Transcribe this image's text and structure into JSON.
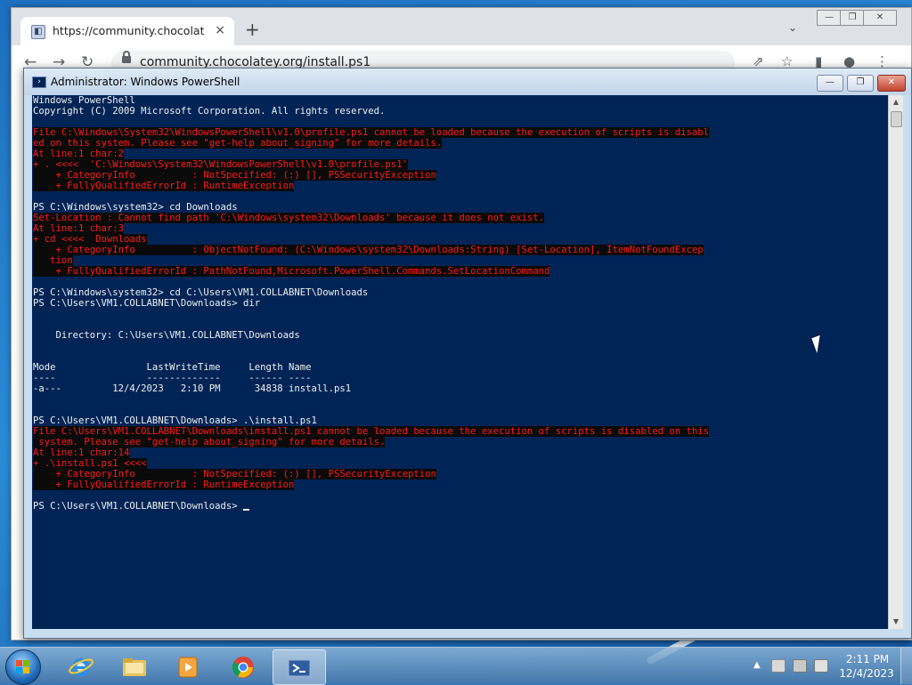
{
  "browser": {
    "tab_title": "https://community.chocolatey.or",
    "tab_close": "×",
    "new_tab": "+",
    "tab_search": "⌄",
    "address": "community.chocolatey.org/install.ps1",
    "window_controls": [
      "—",
      "❐",
      "✕"
    ]
  },
  "powershell": {
    "window_title": "Administrator: Windows PowerShell",
    "controls": [
      "—",
      "❐",
      "✕"
    ],
    "prompt_path": "PS C:\\Users\\VM1.COLLABNET\\Downloads> ",
    "lines": [
      {
        "text": "Windows PowerShell",
        "error": false
      },
      {
        "text": "Copyright (C) 2009 Microsoft Corporation. All rights reserved.",
        "error": false
      },
      {
        "text": "",
        "error": false
      },
      {
        "text": "File C:\\Windows\\System32\\WindowsPowerShell\\v1.0\\profile.ps1 cannot be loaded because the execution of scripts is disabl",
        "error": true
      },
      {
        "text": "ed on this system. Please see \"get-help about_signing\" for more details.",
        "error": true
      },
      {
        "text": "At line:1 char:2",
        "error": true
      },
      {
        "text": "+ . <<<<  'C:\\Windows\\System32\\WindowsPowerShell\\v1.0\\profile.ps1'",
        "error": true
      },
      {
        "text": "    + CategoryInfo          : NotSpecified: (:) [], PSSecurityException",
        "error": true
      },
      {
        "text": "    + FullyQualifiedErrorId : RuntimeException",
        "error": true
      },
      {
        "text": "",
        "error": false
      },
      {
        "text": "PS C:\\Windows\\system32> cd Downloads",
        "error": false
      },
      {
        "text": "Set-Location : Cannot find path 'C:\\Windows\\system32\\Downloads' because it does not exist.",
        "error": true
      },
      {
        "text": "At line:1 char:3",
        "error": true
      },
      {
        "text": "+ cd <<<<  Downloads",
        "error": true
      },
      {
        "text": "    + CategoryInfo          : ObjectNotFound: (C:\\Windows\\system32\\Downloads:String) [Set-Location], ItemNotFoundExcep",
        "error": true
      },
      {
        "text": "   tion",
        "error": true
      },
      {
        "text": "    + FullyQualifiedErrorId : PathNotFound,Microsoft.PowerShell.Commands.SetLocationCommand",
        "error": true
      },
      {
        "text": "",
        "error": false
      },
      {
        "text": "PS C:\\Windows\\system32> cd C:\\Users\\VM1.COLLABNET\\Downloads",
        "error": false
      },
      {
        "text": "PS C:\\Users\\VM1.COLLABNET\\Downloads> dir",
        "error": false
      },
      {
        "text": "",
        "error": false
      },
      {
        "text": "",
        "error": false
      },
      {
        "text": "    Directory: C:\\Users\\VM1.COLLABNET\\Downloads",
        "error": false
      },
      {
        "text": "",
        "error": false
      },
      {
        "text": "",
        "error": false
      },
      {
        "text": "Mode                LastWriteTime     Length Name",
        "error": false
      },
      {
        "text": "----                -------------     ------ ----",
        "error": false
      },
      {
        "text": "-a---         12/4/2023   2:10 PM      34838 install.ps1",
        "error": false
      },
      {
        "text": "",
        "error": false
      },
      {
        "text": "",
        "error": false
      },
      {
        "text": "PS C:\\Users\\VM1.COLLABNET\\Downloads> .\\install.ps1",
        "error": false
      },
      {
        "text": "File C:\\Users\\VM1.COLLABNET\\Downloads\\install.ps1 cannot be loaded because the execution of scripts is disabled on this",
        "error": true
      },
      {
        "text": " system. Please see \"get-help about_signing\" for more details.",
        "error": true
      },
      {
        "text": "At line:1 char:14",
        "error": true
      },
      {
        "text": "+ .\\install.ps1 <<<<",
        "error": true
      },
      {
        "text": "    + CategoryInfo          : NotSpecified: (:) [], PSSecurityException",
        "error": true
      },
      {
        "text": "    + FullyQualifiedErrorId : RuntimeException",
        "error": true
      },
      {
        "text": "",
        "error": false
      }
    ]
  },
  "taskbar": {
    "time": "2:11 PM",
    "date": "12/4/2023",
    "tray_arrow": "▲"
  }
}
